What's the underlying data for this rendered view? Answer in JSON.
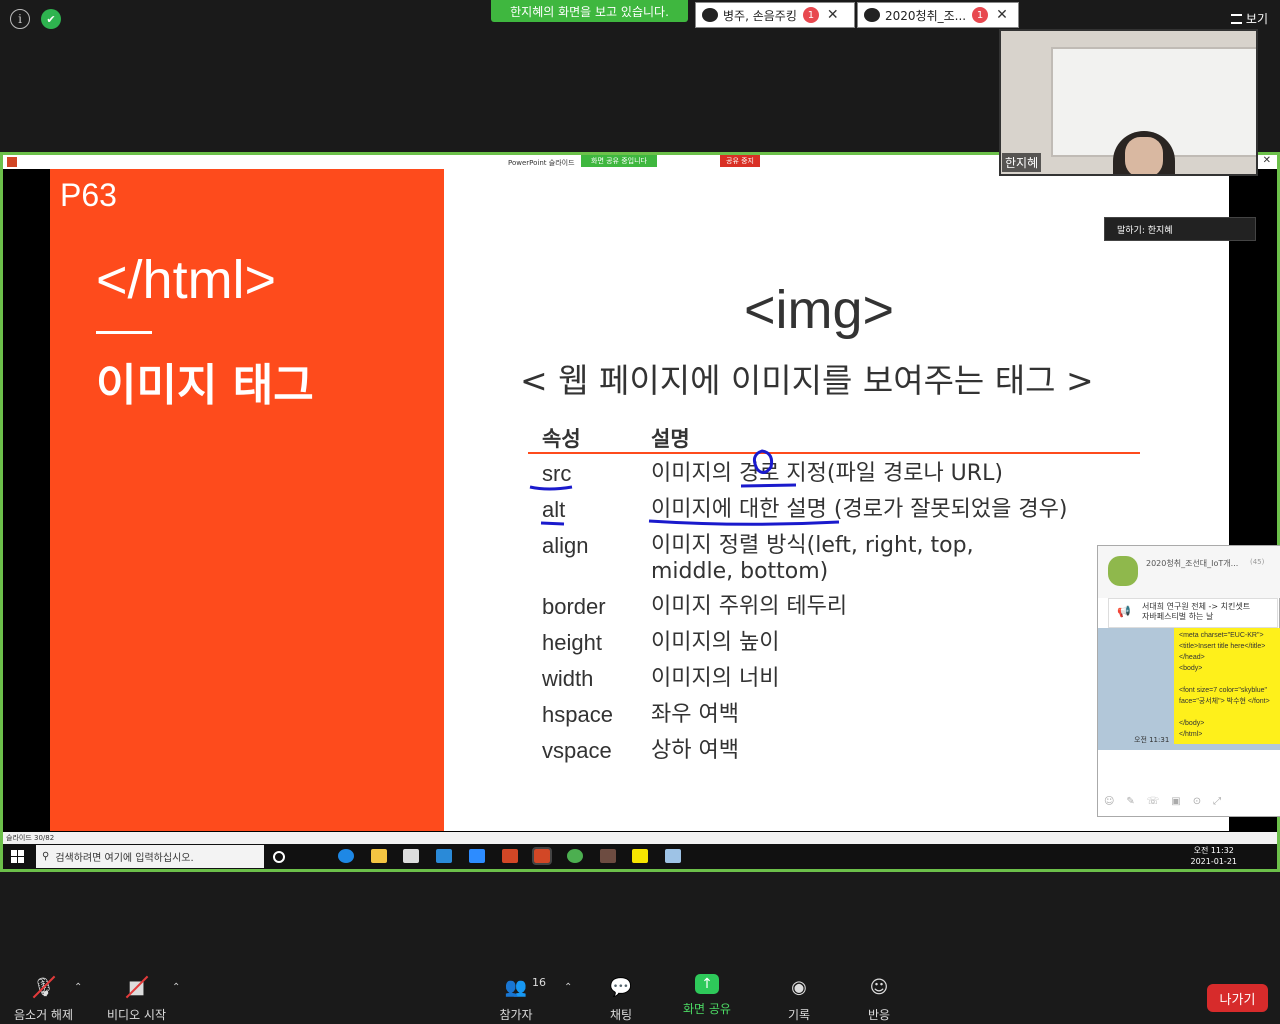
{
  "top": {
    "viewing_banner": "한지혜의 화면을 보고 있습니다.",
    "chat_tabs": [
      {
        "label": "병주, 손음주킹",
        "badge": "1"
      },
      {
        "label": "2020청취_조...",
        "badge": "1"
      }
    ],
    "view_label": "보기"
  },
  "share": {
    "app_title": "PowerPoint 슬라이드",
    "sharing_label": "화면 공유 중입니다",
    "stop_label": "공유 중지"
  },
  "slide": {
    "page": "P63",
    "tag": "</html>",
    "topic": "이미지 태그",
    "title": "<img>",
    "subtitle": "< 웹 페이지에 이미지를 보여주는 태그 >",
    "headers": {
      "attr": "속성",
      "desc": "설명"
    },
    "rows": [
      {
        "k": "src",
        "v": "이미지의 경로 지정(파일 경로나 URL)"
      },
      {
        "k": "alt",
        "v": "이미지에 대한 설명 (경로가 잘못되었을 경우)"
      },
      {
        "k": "align",
        "v": "이미지 정렬 방식(left, right, top, middle, bottom)"
      },
      {
        "k": "border",
        "v": "이미지 주위의 테두리"
      },
      {
        "k": "height",
        "v": "이미지의 높이"
      },
      {
        "k": "width",
        "v": "이미지의 너비"
      },
      {
        "k": "hspace",
        "v": "좌우 여백"
      },
      {
        "k": "vspace",
        "v": "상하 여백"
      }
    ],
    "status": "슬라이드 30/82"
  },
  "windows": {
    "search_placeholder": "검색하려면 여기에 입력하십시오.",
    "time": "오전 11:32",
    "date": "2021-01-21"
  },
  "kakao": {
    "room_name": "2020청취_조선대_IoT개...",
    "member_count": "(45)",
    "notice": "서대희 연구원 전체 -> 치킨셋트\n자바페스티벌 하는 날",
    "message": "<meta charset=\"EUC-KR\">\n<title>Insert title here</title>\n</head>\n<body>\n\n<font size=7 color=\"skyblue\"\nface=\"궁서체\"> 박수현 </font>\n\n</body>\n</html>",
    "msg_time": "오전 11:31"
  },
  "video": {
    "name": "한지혜",
    "speaking": "말하기: 한지혜"
  },
  "controls": {
    "mute": "음소거 해제",
    "video": "비디오 시작",
    "participants": "참가자",
    "participants_count": "16",
    "chat": "채팅",
    "share": "화면 공유",
    "record": "기록",
    "reactions": "반응",
    "leave": "나가기"
  },
  "colors": {
    "slide_accent": "#fe4b1c",
    "share_green": "#3fb73f",
    "leave_red": "#d72b2b"
  }
}
